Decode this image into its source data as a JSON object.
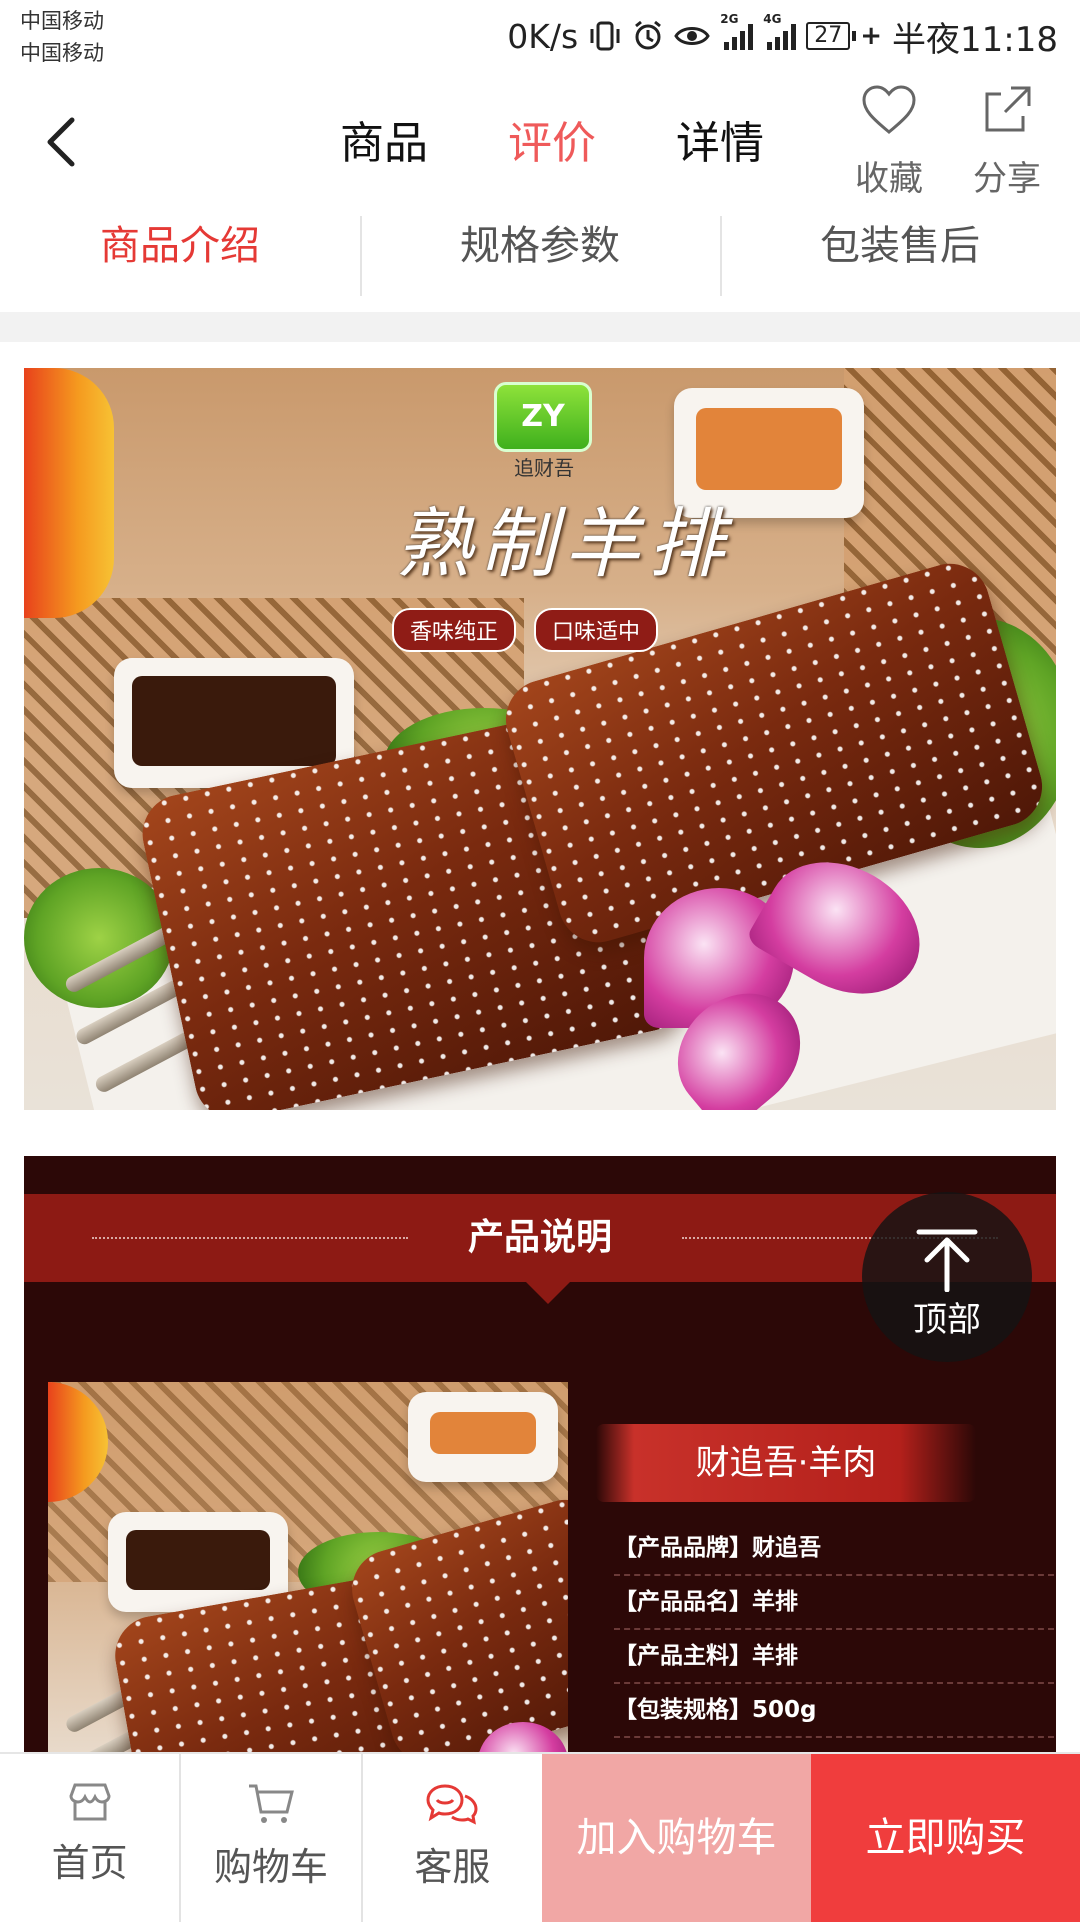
{
  "status_bar": {
    "carrier_1": "中国移动",
    "carrier_2": "中国移动",
    "net_speed": "0K/s",
    "signal_1_label": "2G",
    "signal_2_label": "4G",
    "battery": "27",
    "time": "半夜11:18"
  },
  "header": {
    "tabs": [
      {
        "label": "商品"
      },
      {
        "label": "评价"
      },
      {
        "label": "详情"
      }
    ],
    "active_tab": "评价",
    "favorite_label": "收藏",
    "share_label": "分享"
  },
  "sub_tabs": [
    {
      "label": "商品介绍"
    },
    {
      "label": "规格参数"
    },
    {
      "label": "包装售后"
    }
  ],
  "hero": {
    "logo_text": "ZY",
    "brand_name": "追财吾",
    "calligraphy_title": "熟制羊排",
    "tags": [
      "香味纯正",
      "口味适中"
    ]
  },
  "product_desc": {
    "section_title": "产品说明",
    "banner_title": "财追吾·羊肉",
    "specs": [
      "【产品品牌】财追吾",
      "【产品品名】羊排",
      "【产品主料】羊排",
      "【包装规格】500g"
    ]
  },
  "back_to_top_label": "顶部",
  "bottom_bar": {
    "home_label": "首页",
    "cart_label": "购物车",
    "service_label": "客服",
    "add_to_cart_label": "加入购物车",
    "buy_now_label": "立即购买"
  },
  "colors": {
    "accent": "#ef5a5a",
    "add_to_cart_bg": "#f1a7a5",
    "buy_now_bg": "#f03d3d",
    "desc_bg": "#2c0807",
    "desc_bar": "#8d1a14"
  }
}
